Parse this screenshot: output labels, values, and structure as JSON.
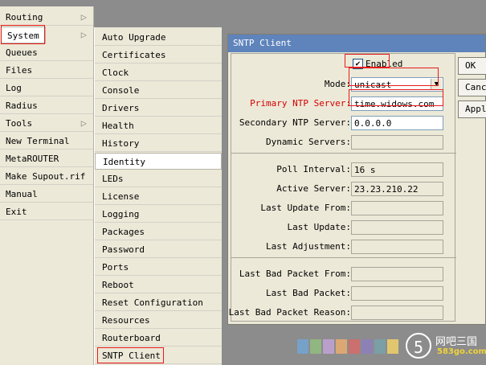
{
  "left_menu": {
    "items": [
      {
        "label": "Routing",
        "arrow": true
      },
      {
        "label": "System",
        "arrow": true
      },
      {
        "label": "Queues"
      },
      {
        "label": "Files"
      },
      {
        "label": "Log"
      },
      {
        "label": "Radius"
      },
      {
        "label": "Tools",
        "arrow": true
      },
      {
        "label": "New Terminal"
      },
      {
        "label": "MetaROUTER"
      },
      {
        "label": "Make Supout.rif"
      },
      {
        "label": "Manual"
      },
      {
        "label": "Exit"
      }
    ]
  },
  "system_menu": {
    "items": [
      "Auto Upgrade",
      "Certificates",
      "Clock",
      "Console",
      "Drivers",
      "Health",
      "History",
      "Identity",
      "LEDs",
      "License",
      "Logging",
      "Packages",
      "Password",
      "Ports",
      "Reboot",
      "Reset Configuration",
      "Resources",
      "Routerboard",
      "SNTP Client"
    ]
  },
  "dialog": {
    "title": "SNTP Client",
    "enabled_label": "Enabled",
    "enabled": true,
    "mode_label": "Mode:",
    "mode_value": "unicast",
    "primary_label": "Primary NTP Server:",
    "primary_value": "time.widows.com",
    "secondary_label": "Secondary NTP Server:",
    "secondary_value": "0.0.0.0",
    "dynamic_label": "Dynamic Servers:",
    "dynamic_value": "",
    "poll_label": "Poll Interval:",
    "poll_value": "16 s",
    "active_label": "Active Server:",
    "active_value": "23.23.210.22",
    "last_update_from_label": "Last Update From:",
    "last_update_from_value": "",
    "last_update_label": "Last Update:",
    "last_update_value": "",
    "last_adjustment_label": "Last Adjustment:",
    "last_adjustment_value": "",
    "last_bad_from_label": "Last Bad Packet From:",
    "last_bad_from_value": "",
    "last_bad_label": "Last Bad Packet:",
    "last_bad_value": "",
    "last_bad_reason_label": "Last Bad Packet Reason:",
    "last_bad_reason_value": "",
    "ok_label": "OK",
    "cancel_label": "Cancel",
    "apply_label": "Apply"
  },
  "watermark": {
    "cn": "网吧三国",
    "url": "583go.com"
  },
  "colors": {
    "highlight": "#e81b1b",
    "title_bar": "#5f84bb",
    "panel": "#ece9d8"
  }
}
